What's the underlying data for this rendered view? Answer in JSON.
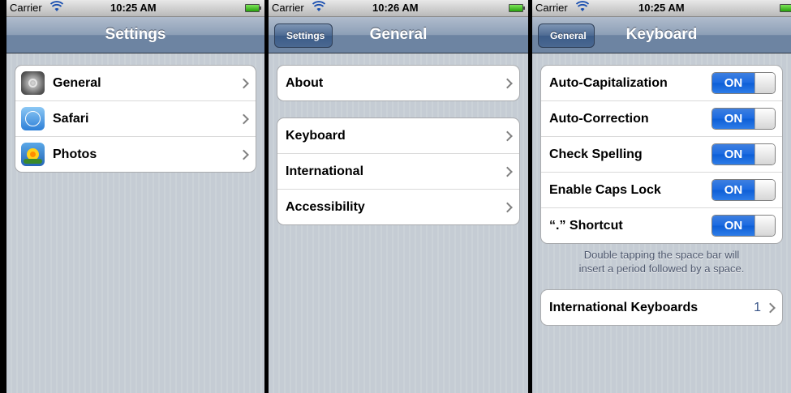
{
  "screens": [
    {
      "status": {
        "carrier": "Carrier",
        "time": "10:25 AM"
      },
      "nav": {
        "title": "Settings"
      },
      "items": [
        {
          "label": "General",
          "icon": "gear-icon"
        },
        {
          "label": "Safari",
          "icon": "compass-icon"
        },
        {
          "label": "Photos",
          "icon": "sunflower-icon"
        }
      ]
    },
    {
      "status": {
        "carrier": "Carrier",
        "time": "10:26 AM"
      },
      "nav": {
        "title": "General",
        "back": "Settings"
      },
      "group1": [
        {
          "label": "About"
        }
      ],
      "group2": [
        {
          "label": "Keyboard"
        },
        {
          "label": "International"
        },
        {
          "label": "Accessibility"
        }
      ]
    },
    {
      "status": {
        "carrier": "Carrier",
        "time": "10:25 AM"
      },
      "nav": {
        "title": "Keyboard",
        "back": "General"
      },
      "toggles": [
        {
          "label": "Auto-Capitalization",
          "state": "ON"
        },
        {
          "label": "Auto-Correction",
          "state": "ON"
        },
        {
          "label": "Check Spelling",
          "state": "ON"
        },
        {
          "label": "Enable Caps Lock",
          "state": "ON"
        },
        {
          "label": "“.” Shortcut",
          "state": "ON"
        }
      ],
      "footer_line1": "Double tapping the space bar will",
      "footer_line2": "insert a period followed by a space.",
      "intl": {
        "label": "International Keyboards",
        "value": "1"
      }
    }
  ],
  "colors": {
    "switch_on": "#1a6ae1",
    "nav_bar": "#6d84a2",
    "detail_text": "#385487"
  }
}
